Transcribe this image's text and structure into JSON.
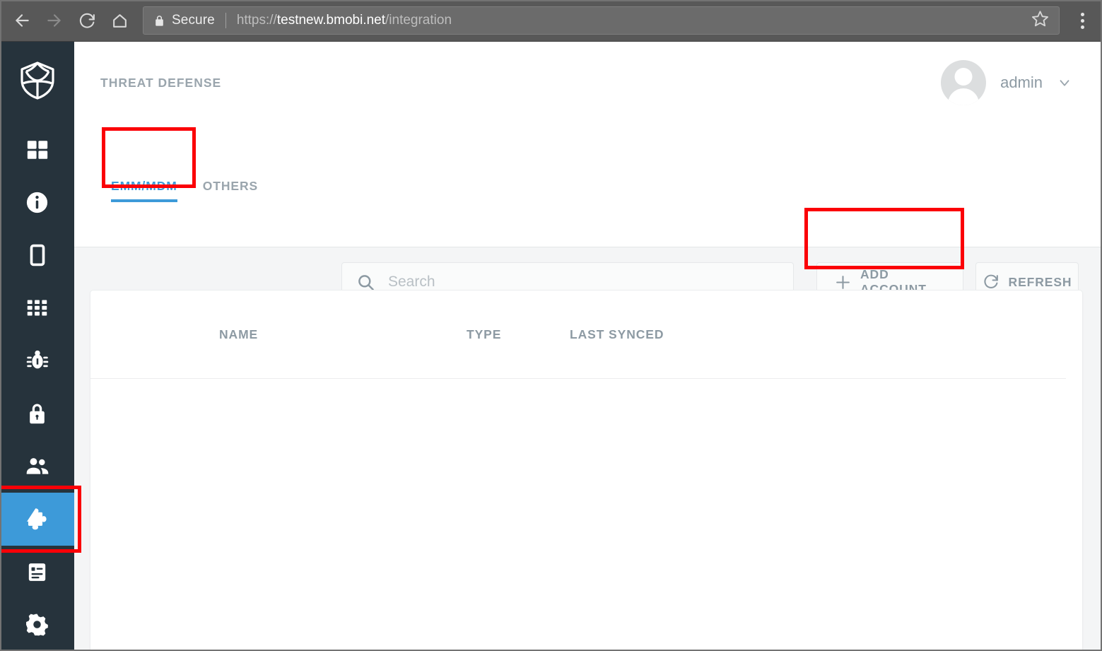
{
  "browser": {
    "back_icon": "arrow-left-icon",
    "forward_icon": "arrow-right-icon",
    "reload_icon": "reload-icon",
    "home_icon": "home-icon",
    "lock_icon": "lock-icon",
    "secure_label": "Secure",
    "url_scheme": "https://",
    "url_host": "testnew.bmobi.net",
    "url_path": "/integration",
    "bookmark_icon": "star-icon",
    "menu_icon": "kebab-menu-icon"
  },
  "sidebar": {
    "logo_icon": "shield-logo-icon",
    "items": [
      {
        "name": "dashboard",
        "icon": "grid-2x2-icon",
        "active": false
      },
      {
        "name": "information",
        "icon": "info-circle-icon",
        "active": false
      },
      {
        "name": "devices",
        "icon": "mobile-phone-icon",
        "active": false
      },
      {
        "name": "apps",
        "icon": "grid-3x3-icon",
        "active": false
      },
      {
        "name": "threats",
        "icon": "bug-icon",
        "active": false
      },
      {
        "name": "security",
        "icon": "lock-icon",
        "active": false
      },
      {
        "name": "users",
        "icon": "people-icon",
        "active": false
      },
      {
        "name": "integration",
        "icon": "puzzle-piece-icon",
        "active": true
      },
      {
        "name": "reports",
        "icon": "document-icon",
        "active": false
      },
      {
        "name": "settings",
        "icon": "gear-icon",
        "active": false
      }
    ]
  },
  "header": {
    "title": "THREAT DEFENSE",
    "avatar_icon": "user-avatar-icon",
    "username": "admin",
    "chevron_icon": "chevron-down-icon"
  },
  "tabs": [
    {
      "label": "EMM/MDM",
      "active": true
    },
    {
      "label": "OTHERS",
      "active": false
    }
  ],
  "toolbar": {
    "search_icon": "search-icon",
    "search_value": "",
    "search_placeholder": "Search",
    "add_account_icon": "plus-icon",
    "add_account_label": "ADD ACCOUNT",
    "refresh_icon": "refresh-icon",
    "refresh_label": "REFRESH"
  },
  "table": {
    "columns": [
      "NAME",
      "TYPE",
      "LAST SYNCED"
    ],
    "rows": []
  },
  "annotations": {
    "highlight_color": "#fb0007",
    "boxes": [
      "emm-mdm-tab",
      "add-account-button",
      "integration-sidebar-item"
    ]
  },
  "colors": {
    "accent": "#3d9ad9",
    "sidebar_bg": "#26333c",
    "content_bg": "#f4f5f6",
    "text_muted": "#8d9aa3",
    "browser_chrome": "#585858"
  }
}
